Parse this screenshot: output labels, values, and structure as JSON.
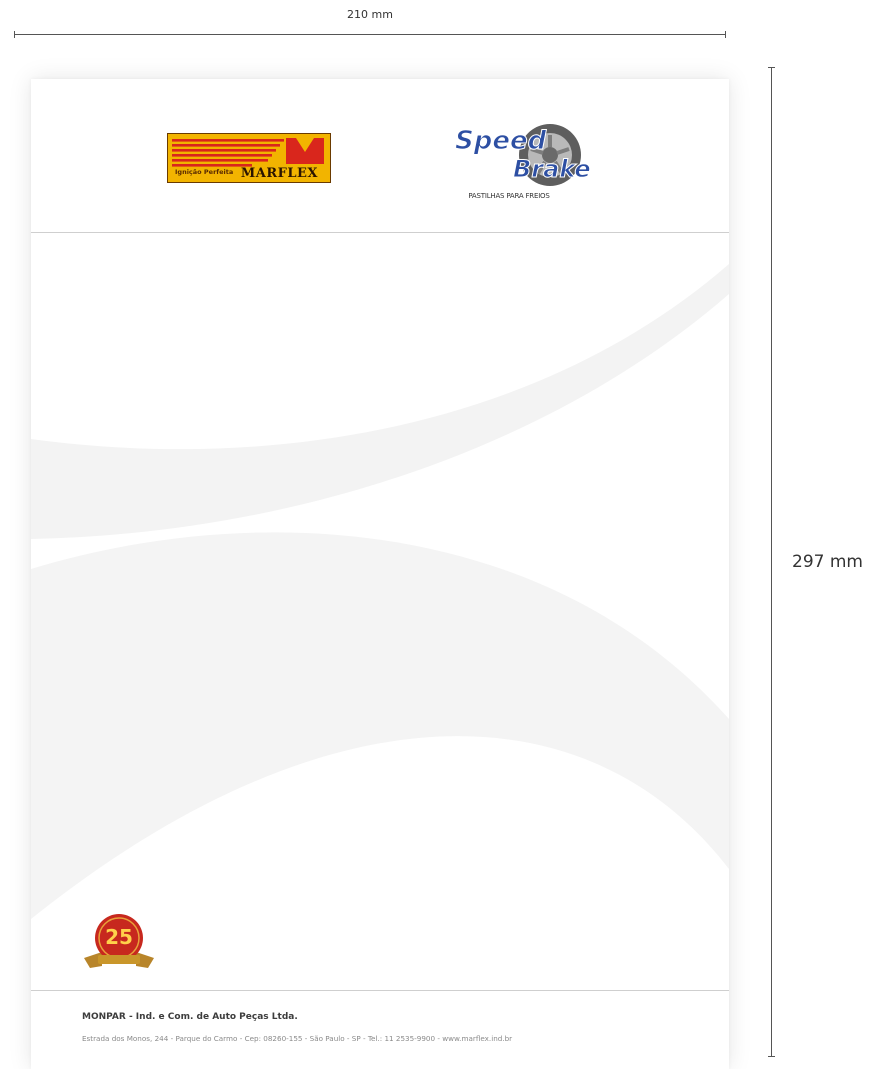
{
  "dimensions": {
    "width_label": "210 mm",
    "height_label": "297 mm"
  },
  "logos": {
    "marflex": {
      "tagline": "Ignição Perfeita",
      "brand": "MARFLEX",
      "registered": "®",
      "colors": {
        "background": "#f2b400",
        "stripes": "#d9261c",
        "mark": "#d9261c"
      }
    },
    "speed_brake": {
      "word1": "Speed",
      "word2": "Brake",
      "tagline": "PASTILHAS PARA FREIOS",
      "colors": {
        "text": "#2d4fa3",
        "wheel": "#6b6b6b"
      }
    },
    "seal": {
      "number": "25",
      "colors": {
        "disc": "#c7281e",
        "ribbon": "#c9962a"
      }
    }
  },
  "footer": {
    "company": "MONPAR - Ind. e Com. de Auto Peças Ltda.",
    "address": "Estrada dos Monos, 244 - Parque do Carmo - Cep: 08260-155 - São Paulo - SP - Tel.: 11 2535-9900 - www.marflex.ind.br"
  },
  "colors": {
    "divider": "#cfcfcf",
    "background_swoosh": "#f3f3f3"
  }
}
